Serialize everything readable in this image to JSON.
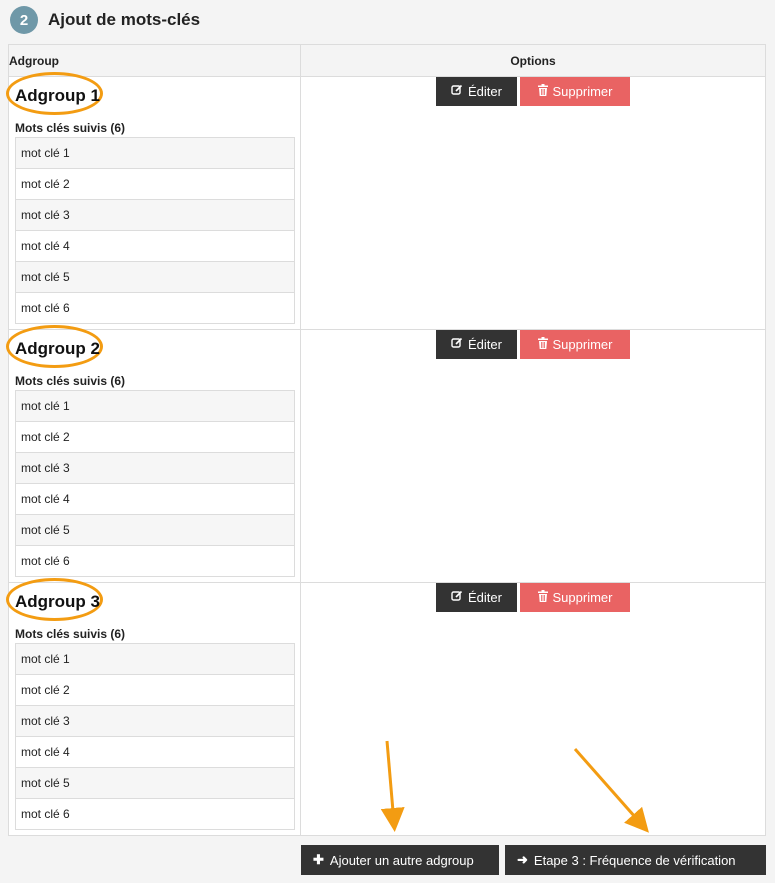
{
  "step": {
    "number": "2",
    "title": "Ajout de mots-clés"
  },
  "table": {
    "col_adgroup": "Adgroup",
    "col_options": "Options"
  },
  "adgroups": [
    {
      "name": "Adgroup 1",
      "keywords_title": "Mots clés suivis (6)",
      "keywords": [
        "mot clé 1",
        "mot clé 2",
        "mot clé 3",
        "mot clé 4",
        "mot clé 5",
        "mot clé 6"
      ]
    },
    {
      "name": "Adgroup 2",
      "keywords_title": "Mots clés suivis (6)",
      "keywords": [
        "mot clé 1",
        "mot clé 2",
        "mot clé 3",
        "mot clé 4",
        "mot clé 5",
        "mot clé 6"
      ]
    },
    {
      "name": "Adgroup 3",
      "keywords_title": "Mots clés suivis (6)",
      "keywords": [
        "mot clé 1",
        "mot clé 2",
        "mot clé 3",
        "mot clé 4",
        "mot clé 5",
        "mot clé 6"
      ]
    }
  ],
  "options": {
    "edit_label": "Éditer",
    "delete_label": "Supprimer",
    "edit_icon": "edit-icon",
    "delete_icon": "trash-icon"
  },
  "footer": {
    "add_label": "Ajouter un autre adgroup",
    "add_icon": "plus-icon",
    "next_label": "Etape 3 : Fréquence de vérification",
    "next_icon": "arrow-right-icon"
  },
  "colors": {
    "badge": "#6f98a8",
    "annotation": "#f39c12",
    "delete_button": "#e96363",
    "dark_button": "#333333"
  }
}
